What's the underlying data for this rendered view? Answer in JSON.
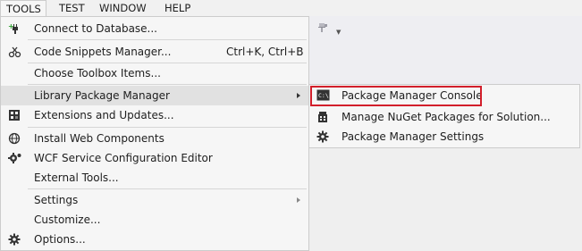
{
  "menubar": {
    "items": [
      {
        "label": "TOOLS"
      },
      {
        "label": "TEST"
      },
      {
        "label": "WINDOW"
      },
      {
        "label": "HELP"
      }
    ]
  },
  "toolbar": {
    "icons": [
      "pin-icon",
      "dropdown-arrow-icon"
    ]
  },
  "tools_menu": {
    "items": [
      {
        "label": "Connect to Database...",
        "icon": "database-plug-icon"
      },
      {
        "label": "Code Snippets Manager...",
        "shortcut": "Ctrl+K, Ctrl+B",
        "icon": "code-snippet-icon"
      },
      {
        "label": "Choose Toolbox Items..."
      },
      {
        "label": "Library Package Manager",
        "has_submenu": true,
        "highlighted": true
      },
      {
        "label": "Extensions and Updates...",
        "icon": "extensions-icon"
      },
      {
        "label": "Install Web Components",
        "icon": "web-globe-icon"
      },
      {
        "label": "WCF Service Configuration Editor",
        "icon": "wcf-gear-icon"
      },
      {
        "label": "External Tools..."
      },
      {
        "label": "Settings",
        "has_submenu": true
      },
      {
        "label": "Customize..."
      },
      {
        "label": "Options...",
        "icon": "gear-icon"
      }
    ]
  },
  "submenu": {
    "items": [
      {
        "label": "Package Manager Console",
        "icon": "console-icon",
        "highlighted": true
      },
      {
        "label": "Manage NuGet Packages for Solution...",
        "icon": "nuget-package-icon"
      },
      {
        "label": "Package Manager Settings",
        "icon": "gear-icon"
      }
    ]
  },
  "colors": {
    "highlight_border": "#d21f2b",
    "menu_background": "#f6f6f6",
    "hover_background": "#e1e1e1"
  }
}
